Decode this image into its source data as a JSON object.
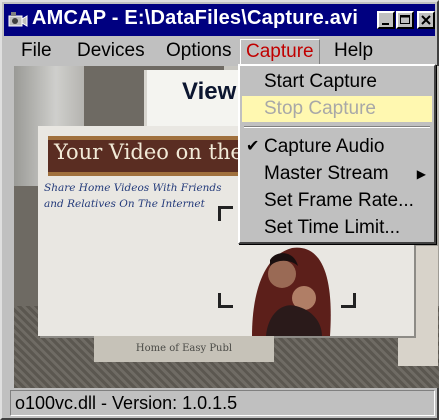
{
  "window": {
    "title": "AMCAP - E:\\DataFiles\\Capture.avi"
  },
  "menubar": {
    "items": [
      {
        "label": "File"
      },
      {
        "label": "Devices"
      },
      {
        "label": "Options"
      },
      {
        "label": "Capture"
      },
      {
        "label": "Help"
      }
    ]
  },
  "capture_menu": {
    "items": [
      {
        "label": "Start Capture"
      },
      {
        "label": "Stop Capture"
      },
      {
        "label": "Capture Audio",
        "checked": true
      },
      {
        "label": "Master Stream",
        "submenu": true
      },
      {
        "label": "Set Frame Rate..."
      },
      {
        "label": "Set Time Limit..."
      }
    ]
  },
  "video": {
    "back_sign_text": "View",
    "banner_text": "Your Video on the W",
    "tagline_line1": "Share Home Videos With Friends",
    "tagline_line2": "and Relatives On The Internet",
    "box_bottom_text": "Home of Easy Publ"
  },
  "statusbar": {
    "text": "o100vc.dll - Version:  1.0.1.5"
  },
  "colors": {
    "titlebar": "#000080",
    "menu_active_text": "#c00000",
    "highlight": "#fff8b0"
  }
}
